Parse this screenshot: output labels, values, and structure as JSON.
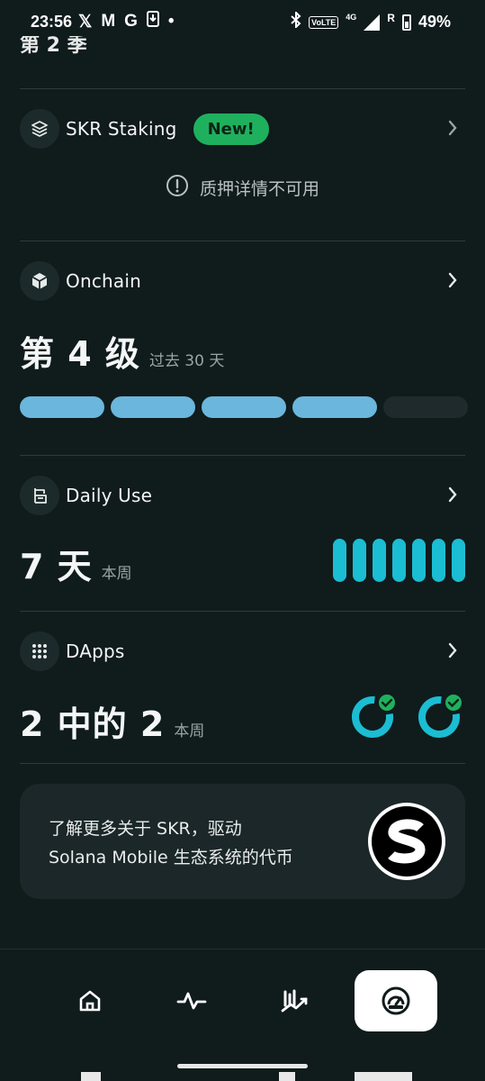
{
  "status_bar": {
    "time": "23:56",
    "notification_icons": [
      "x-icon",
      "gmail-icon",
      "google-icon",
      "download-icon",
      "dot-icon"
    ],
    "network": "4G",
    "volte": "VoLTE",
    "roaming": "R",
    "battery": "49%"
  },
  "season": {
    "label": "第 2 季"
  },
  "staking": {
    "title": "SKR Staking",
    "badge": "New!",
    "unavailable_text": "质押详情不可用"
  },
  "onchain": {
    "title": "Onchain",
    "level_text": "第 4 级",
    "period": "过去 30 天",
    "levels_filled": 4,
    "levels_total": 5
  },
  "daily_use": {
    "title": "Daily Use",
    "value": "7 天",
    "period": "本周",
    "days_active": 7
  },
  "dapps": {
    "title": "DApps",
    "value": "2 中的 2",
    "period": "本周"
  },
  "promo": {
    "line1": "了解更多关于 SKR，驱动",
    "line2": "Solana Mobile 生态系统的代币"
  },
  "nav": {
    "items": [
      "home-icon",
      "activity-icon",
      "chart-icon",
      "gauge-icon"
    ],
    "active": "gauge-icon"
  },
  "colors": {
    "background": "#101b1c",
    "badge_green": "#1fb05e",
    "level_blue": "#6bb6dc",
    "day_cyan": "#1bbdd3",
    "check_green": "#1fb05e"
  }
}
